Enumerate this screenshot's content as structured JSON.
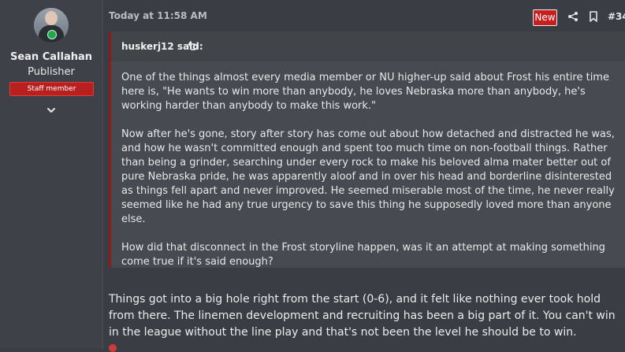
{
  "user": {
    "name": "Sean Callahan",
    "title": "Publisher",
    "badge": "Staff member"
  },
  "post": {
    "timestamp": "Today at 11:58 AM",
    "new_label": "New",
    "number": "#34"
  },
  "quote": {
    "author": "huskerj12 said:",
    "paragraphs": [
      "One of the things almost every media member or NU higher-up said about Frost his entire time here is, \"He wants to win more than anybody, he loves Nebraska more than anybody, he's working harder than anybody to make this work.\"",
      "Now after he's gone, story after story has come out about how detached and distracted he was, and how he wasn't committed enough and spent too much time on non-football things. Rather than being a grinder, searching under every rock to make his beloved alma mater better out of pure Nebraska pride, he was apparently aloof and in over his head and borderline disinterested as things fell apart and never improved. He seemed miserable most of the time, he never really seemed like he had any true urgency to save this thing he supposedly loved more than anyone else.",
      "How did that disconnect in the Frost storyline happen, was it an attempt at making something come true if it's said enough?"
    ]
  },
  "reply": {
    "text": "Things got into a big hole right from the start (0-6), and it felt like nothing ever took hold from there. The linemen development and recruiting has been a big part of it. You can't win in the league without the line play and that's not been the level he should be to win."
  },
  "icons": {
    "expand": "chevron-down-icon",
    "share": "share-icon",
    "bookmark": "bookmark-icon",
    "quote_jump": "arrow-up-left-icon"
  },
  "colors": {
    "staff_badge": "#b81f1f",
    "new_badge": "#c81e1e",
    "quote_border": "#8a1c1c"
  }
}
